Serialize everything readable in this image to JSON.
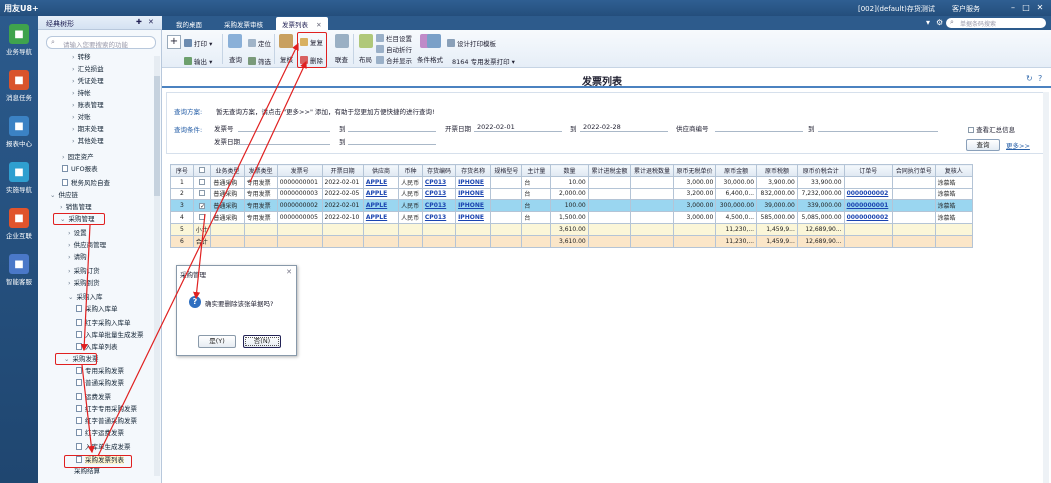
{
  "titlebar": {
    "brand": "用友U8+",
    "context": "[002](default)存货测试",
    "service": "客户服务"
  },
  "leftnav": [
    {
      "label": "业务导航",
      "color": "#3fa34d"
    },
    {
      "label": "消息任务",
      "color": "#d9532c"
    },
    {
      "label": "报表中心",
      "color": "#3b82c4"
    },
    {
      "label": "实施导航",
      "color": "#2f9fd0"
    },
    {
      "label": "企业互联",
      "color": "#e0542c"
    },
    {
      "label": "智能客服",
      "color": "#4a78c8"
    }
  ],
  "tree": {
    "header": "经典树形",
    "search_placeholder": "请输入您要搜索的功能",
    "nodes": [
      {
        "label": "转移",
        "toggle": "›",
        "doc": false
      },
      {
        "label": "汇兑损益",
        "toggle": "›",
        "doc": false
      },
      {
        "label": "凭证处理",
        "toggle": "›",
        "doc": false
      },
      {
        "label": "持帐",
        "toggle": "›",
        "doc": false
      },
      {
        "label": "账表管理",
        "toggle": "›",
        "doc": false
      },
      {
        "label": "对账",
        "toggle": "›",
        "doc": false
      },
      {
        "label": "期末处理",
        "toggle": "›",
        "doc": false
      },
      {
        "label": "其他处理",
        "toggle": "›",
        "doc": false
      },
      {
        "label": "固定资产",
        "toggle": "›",
        "doc": false
      },
      {
        "label": "UFO报表",
        "toggle": "",
        "doc": true
      },
      {
        "label": "税务风险自查",
        "toggle": "",
        "doc": true
      },
      {
        "label": "供应链",
        "toggle": "⌄",
        "doc": false
      },
      {
        "label": "销售管理",
        "toggle": "›",
        "doc": false
      },
      {
        "label": "采购管理",
        "toggle": "⌄",
        "doc": false
      },
      {
        "label": "设置",
        "toggle": "›",
        "doc": false
      },
      {
        "label": "供应商管理",
        "toggle": "›",
        "doc": false
      },
      {
        "label": "请购",
        "toggle": "›",
        "doc": false
      },
      {
        "label": "采购订货",
        "toggle": "›",
        "doc": false
      },
      {
        "label": "采购到货",
        "toggle": "›",
        "doc": false
      },
      {
        "label": "采购入库",
        "toggle": "⌄",
        "doc": false
      },
      {
        "label": "采购入库单",
        "toggle": "",
        "doc": true
      },
      {
        "label": "红字采购入库单",
        "toggle": "",
        "doc": true
      },
      {
        "label": "入库单批量生成发票",
        "toggle": "",
        "doc": true
      },
      {
        "label": "入库单列表",
        "toggle": "",
        "doc": true
      },
      {
        "label": "采购发票",
        "toggle": "⌄",
        "doc": false
      },
      {
        "label": "专用采购发票",
        "toggle": "",
        "doc": true
      },
      {
        "label": "普通采购发票",
        "toggle": "",
        "doc": true
      },
      {
        "label": "运费发票",
        "toggle": "",
        "doc": true
      },
      {
        "label": "红字专用采购发票",
        "toggle": "",
        "doc": true
      },
      {
        "label": "红字普通采购发票",
        "toggle": "",
        "doc": true
      },
      {
        "label": "红字运费发票",
        "toggle": "",
        "doc": true
      },
      {
        "label": "入库单生成发票",
        "toggle": "",
        "doc": true
      },
      {
        "label": "采购发票列表",
        "toggle": "",
        "doc": true
      },
      {
        "label": "采购结算",
        "toggle": "",
        "doc": false
      }
    ]
  },
  "tabs": [
    {
      "label": "我的桌面",
      "active": false
    },
    {
      "label": "采购发票审核",
      "active": false
    },
    {
      "label": "发票列表",
      "active": true
    }
  ],
  "global_search_placeholder": "单据条码搜索",
  "toolbar": {
    "print": "打印",
    "output": "输出",
    "query": "查询",
    "locate": "定位",
    "filter": "筛选",
    "review": "复核",
    "copy": "复复",
    "delete": "删除",
    "bulk": "联查",
    "layout": "布局",
    "column_settings": "栏目设置",
    "auto_wrap": "自动折行",
    "merge_display": "合并显示",
    "cond_format": "条件格式",
    "design_print": "设计打印模板",
    "print_template": "8164 专用发票打印"
  },
  "page_title": "发票列表",
  "query": {
    "scheme_label": "查询方案:",
    "scheme_hint": "暂无查询方案，请点击 \"更多>>\" 添加，有助于您更加方便快捷的进行查询!",
    "cond_label": "查询条件:",
    "invoice_no": "发票号",
    "to": "到",
    "invoice_date_label": "开票日期",
    "date_from": "2022-02-01",
    "date_to": "2022-02-28",
    "vendor_no": "供应商编号",
    "invoice_date": "发票日期",
    "show_summary": "查看汇总信息",
    "query_btn": "查询",
    "more": "更多>>"
  },
  "grid": {
    "headers": [
      "序号",
      "",
      "业务类型",
      "发票类型",
      "发票号",
      "开票日期",
      "供应商",
      "币种",
      "存货编码",
      "存货名称",
      "规格型号",
      "主计量",
      "数量",
      "累计进税金额",
      "累计退税数量",
      "原币无税单价",
      "原币金额",
      "原币税额",
      "原币价税合计",
      "订单号",
      "合同执行单号",
      "复核人"
    ],
    "rows": [
      {
        "seq": "1",
        "check": "",
        "biz": "普通采购",
        "type": "专用发票",
        "no": "0000000001",
        "date": "2022-02-01",
        "vendor": "APPLE",
        "cur": "人民币",
        "inv_code": "CP013",
        "inv_name": "IPHONE",
        "spec": "",
        "unit": "台",
        "qty": "10.00",
        "acc_tax": "",
        "acc_qty": "",
        "price": "3,000.00",
        "amount": "30,000.00",
        "tax": "3,900.00",
        "total": "33,900.00",
        "order": "",
        "contract": "",
        "reviewer": "",
        "style": ""
      },
      {
        "seq": "2",
        "check": "",
        "biz": "普通采购",
        "type": "专用发票",
        "no": "0000000003",
        "date": "2022-02-05",
        "vendor": "APPLE",
        "cur": "人民币",
        "inv_code": "CP013",
        "inv_name": "IPHONE",
        "spec": "",
        "unit": "台",
        "qty": "2,000.00",
        "acc_tax": "",
        "acc_qty": "",
        "price": "3,200.00",
        "amount": "6,400,0...",
        "tax": "832,000.00",
        "total": "7,232,000.00",
        "order": "0000000002",
        "contract": "",
        "reviewer": "",
        "style": ""
      },
      {
        "seq": "3",
        "check": "✓",
        "biz": "普通采购",
        "type": "专用发票",
        "no": "0000000002",
        "date": "2022-02-01",
        "vendor": "APPLE",
        "cur": "人民币",
        "inv_code": "CP013",
        "inv_name": "IPHONE",
        "spec": "",
        "unit": "台",
        "qty": "100.00",
        "acc_tax": "",
        "acc_qty": "",
        "price": "3,000.00",
        "amount": "300,000.00",
        "tax": "39,000.00",
        "total": "339,000.00",
        "order": "0000000001",
        "contract": "",
        "reviewer": "",
        "style": "hl"
      },
      {
        "seq": "4",
        "check": "",
        "biz": "普通采购",
        "type": "专用发票",
        "no": "0000000005",
        "date": "2022-02-10",
        "vendor": "APPLE",
        "cur": "人民币",
        "inv_code": "CP013",
        "inv_name": "IPHONE",
        "spec": "",
        "unit": "台",
        "qty": "1,500.00",
        "acc_tax": "",
        "acc_qty": "",
        "price": "3,000.00",
        "amount": "4,500,0...",
        "tax": "585,000.00",
        "total": "5,085,000.00",
        "order": "0000000002",
        "contract": "",
        "reviewer": "",
        "style": ""
      },
      {
        "seq": "5",
        "check": "小计",
        "biz": "",
        "type": "",
        "no": "",
        "date": "",
        "vendor": "",
        "cur": "",
        "inv_code": "",
        "inv_name": "",
        "spec": "",
        "unit": "",
        "qty": "3,610.00",
        "acc_tax": "",
        "acc_qty": "",
        "price": "",
        "amount": "11,230,...",
        "tax": "1,459,9...",
        "total": "12,689,90...",
        "order": "",
        "contract": "",
        "reviewer": "",
        "style": "sub"
      },
      {
        "seq": "6",
        "check": "合计",
        "biz": "",
        "type": "",
        "no": "",
        "date": "",
        "vendor": "",
        "cur": "",
        "inv_code": "",
        "inv_name": "",
        "spec": "",
        "unit": "",
        "qty": "3,610.00",
        "acc_tax": "",
        "acc_qty": "",
        "price": "",
        "amount": "11,230,...",
        "tax": "1,459,9...",
        "total": "12,689,90...",
        "order": "",
        "contract": "",
        "reviewer": "",
        "style": "tot"
      }
    ],
    "reviewers": [
      "",
      "",
      "",
      "",
      "",
      ""
    ],
    "reviewer_col_values": [
      "涂慕皓",
      "涂慕皓",
      "涂慕皓",
      "涂慕皓",
      "",
      ""
    ]
  },
  "dialog": {
    "title": "采购管理",
    "message": "确实要删除该张单据吗?",
    "yes": "是(Y)",
    "no": "否(N)"
  }
}
